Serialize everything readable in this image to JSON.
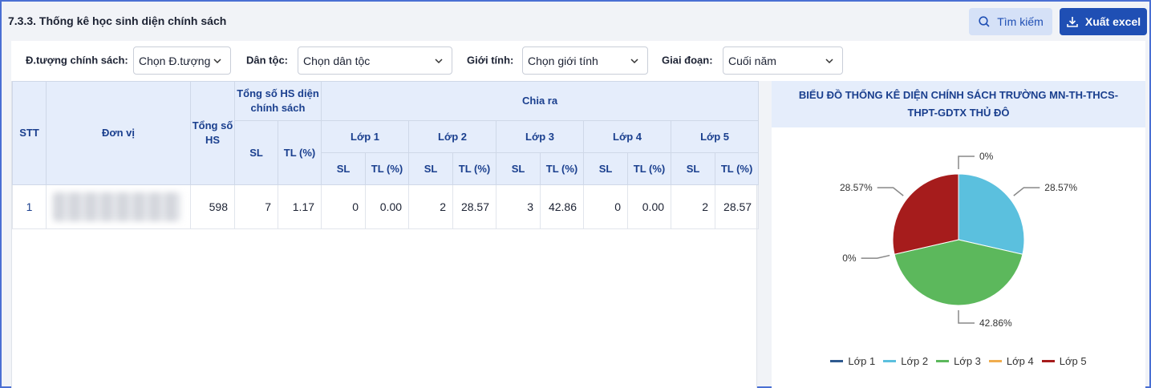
{
  "header": {
    "title": "7.3.3. Thống kê học sinh diện chính sách",
    "search_label": "Tìm kiếm",
    "export_label": "Xuất excel"
  },
  "filters": {
    "policy_label": "Đ.tượng chính sách:",
    "policy_value": "Chọn Đ.tượng",
    "ethnic_label": "Dân tộc:",
    "ethnic_value": "Chọn dân tộc",
    "gender_label": "Giới tính:",
    "gender_value": "Chọn giới tính",
    "stage_label": "Giai đoạn:",
    "stage_value": "Cuối năm"
  },
  "table": {
    "h_stt": "STT",
    "h_unit": "Đơn vị",
    "h_total": "Tổng số HS",
    "h_policy_total": "Tổng số HS diện chính sách",
    "h_breakdown": "Chia ra",
    "h_sl": "SL",
    "h_tl": "TL (%)",
    "classes": [
      "Lớp 1",
      "Lớp 2",
      "Lớp 3",
      "Lớp 4",
      "Lớp 5"
    ],
    "rows": [
      {
        "stt": "1",
        "total": "598",
        "policy_sl": "7",
        "policy_tl": "1.17",
        "c1_sl": "0",
        "c1_tl": "0.00",
        "c2_sl": "2",
        "c2_tl": "28.57",
        "c3_sl": "3",
        "c3_tl": "42.86",
        "c4_sl": "0",
        "c4_tl": "0.00",
        "c5_sl": "2",
        "c5_tl": "28.57"
      }
    ]
  },
  "chart": {
    "title": "BIỂU ĐỒ THỐNG KÊ DIỆN CHÍNH SÁCH TRƯỜNG MN-TH-THCS-THPT-GDTX THỦ ĐÔ"
  },
  "chart_data": {
    "type": "pie",
    "title": "BIỂU ĐỒ THỐNG KÊ DIỆN CHÍNH SÁCH TRƯỜNG MN-TH-THCS-THPT-GDTX THỦ ĐÔ",
    "legend_position": "bottom",
    "slices": [
      {
        "label": "Lớp 1",
        "value": 0,
        "display": "0%",
        "color": "#2f5a8f"
      },
      {
        "label": "Lớp 2",
        "value": 28.57,
        "display": "28.57%",
        "color": "#5bc0de"
      },
      {
        "label": "Lớp 3",
        "value": 42.86,
        "display": "42.86%",
        "color": "#5cb85c"
      },
      {
        "label": "Lớp 4",
        "value": 0,
        "display": "0%",
        "color": "#f0ad4e"
      },
      {
        "label": "Lớp 5",
        "value": 28.57,
        "display": "28.57%",
        "color": "#a61c1c"
      }
    ]
  }
}
